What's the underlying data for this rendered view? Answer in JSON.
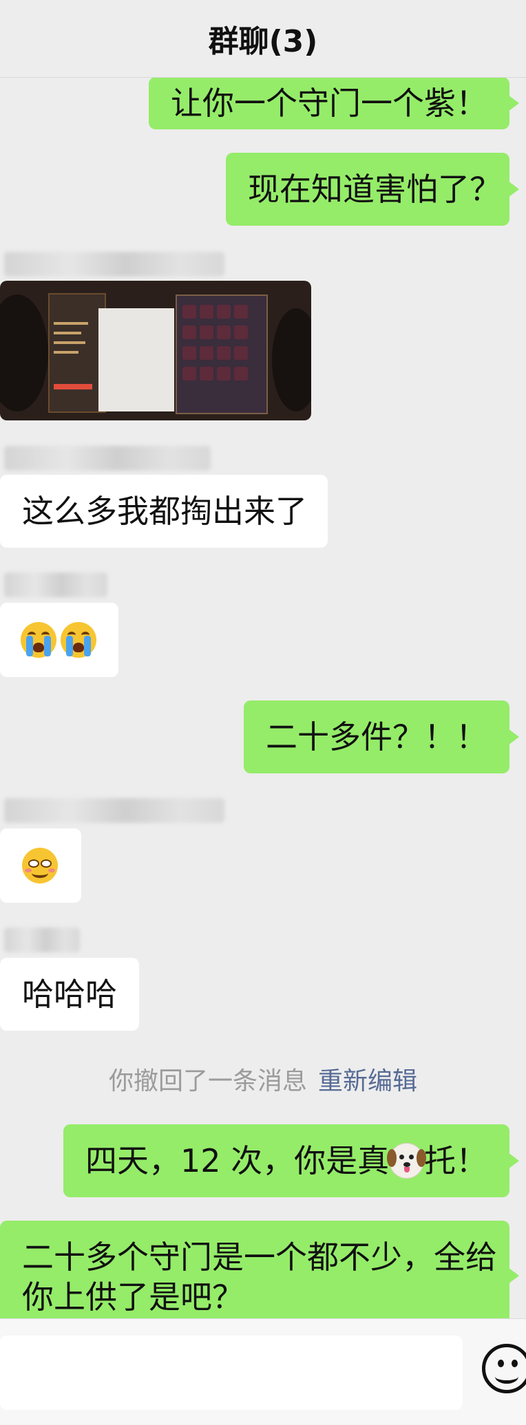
{
  "header": {
    "title": "群聊(3)"
  },
  "messages": [
    {
      "sender": "me",
      "text": "让你一个守门一个紫！"
    },
    {
      "sender": "me",
      "text": "现在知道害怕了？"
    },
    {
      "sender": "other",
      "type": "image"
    },
    {
      "sender": "other",
      "text": "这么多我都掏出来了"
    },
    {
      "sender": "other",
      "type": "emoji",
      "emoji": [
        "loudly-crying-face",
        "loudly-crying-face"
      ]
    },
    {
      "sender": "me",
      "text": "二十多件？！！"
    },
    {
      "sender": "other",
      "type": "emoji",
      "emoji": [
        "smiling-face"
      ]
    },
    {
      "sender": "other",
      "text": "哈哈哈"
    },
    {
      "sender": "me",
      "text_before": "四天，12 次，你是真",
      "emoji": "dog-face",
      "text_after": " 托！"
    },
    {
      "sender": "me",
      "lines": [
        "二十多个守门是一个都不少，全给",
        "你上供了是吧？"
      ]
    }
  ],
  "recall_notice": {
    "text": "你撤回了一条消息",
    "action": "重新编辑"
  },
  "input": {
    "value": "",
    "emoji_icon": "smiley-face-icon"
  }
}
